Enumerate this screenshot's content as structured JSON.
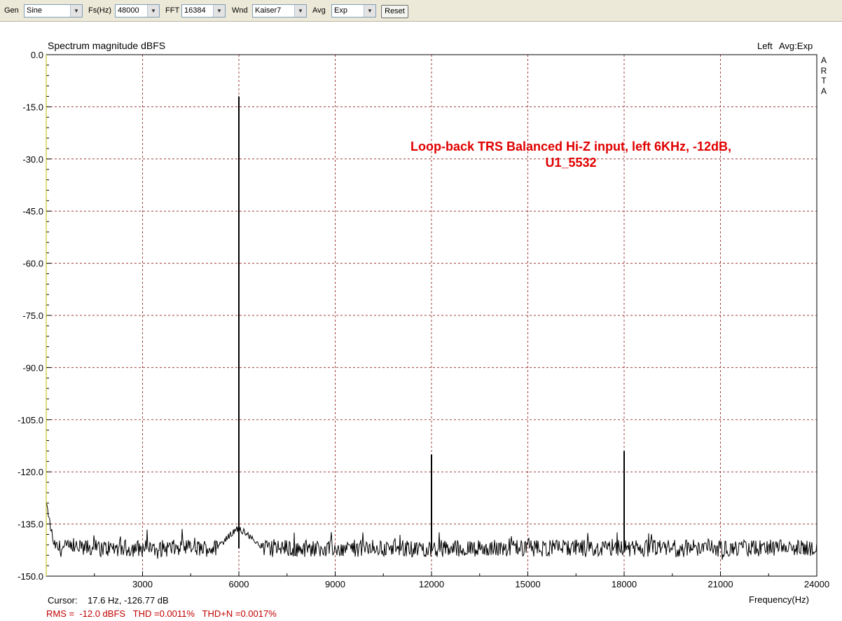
{
  "toolbar": {
    "gen_label": "Gen",
    "gen_value": "Sine",
    "fs_label": "Fs(Hz)",
    "fs_value": "48000",
    "fft_label": "FFT",
    "fft_value": "16384",
    "wnd_label": "Wnd",
    "wnd_value": "Kaiser7",
    "avg_label": "Avg",
    "avg_value": "Exp",
    "reset_label": "Reset"
  },
  "header": {
    "left": "Spectrum magnitude dBFS",
    "channel": "Left",
    "avg": "Avg:Exp",
    "brand": [
      "A",
      "R",
      "T",
      "A"
    ]
  },
  "annotation": {
    "line1": "Loop-back TRS Balanced Hi-Z input, left 6KHz, -12dB,",
    "line2": "U1_5532"
  },
  "footer": {
    "cursor": "Cursor:    17.6 Hz, -126.77 dB",
    "stats": "RMS =  -12.0 dBFS   THD =0.0011%   THD+N =0.0017%"
  },
  "chart_data": {
    "type": "line",
    "title": "Spectrum magnitude dBFS",
    "xlabel": "Frequency(Hz)",
    "ylabel": "",
    "xlim": [
      0,
      24000
    ],
    "ylim": [
      -150,
      0
    ],
    "x_ticks": [
      3000,
      6000,
      9000,
      12000,
      15000,
      18000,
      21000,
      24000
    ],
    "x_tick_labels": [
      "3000",
      "6000",
      "9000",
      "12000",
      "15000",
      "18000",
      "21000",
      "24000"
    ],
    "y_ticks": [
      0,
      -15,
      -30,
      -45,
      -60,
      -75,
      -90,
      -105,
      -120,
      -135,
      -150
    ],
    "y_tick_labels": [
      "0.0",
      "-15.0",
      "-30.0",
      "-45.0",
      "-60.0",
      "-75.0",
      "-90.0",
      "-105.0",
      "-120.0",
      "-135.0",
      "-150.0"
    ],
    "grid": true,
    "line_color": "#000000",
    "grid_color": "#a04040",
    "noise_floor_db": -142,
    "series": [
      {
        "peaks": [
          {
            "x": 0,
            "y": -129
          },
          {
            "x": 6000,
            "y": -12
          },
          {
            "x": 12000,
            "y": -115
          },
          {
            "x": 18000,
            "y": -114
          }
        ]
      }
    ]
  }
}
